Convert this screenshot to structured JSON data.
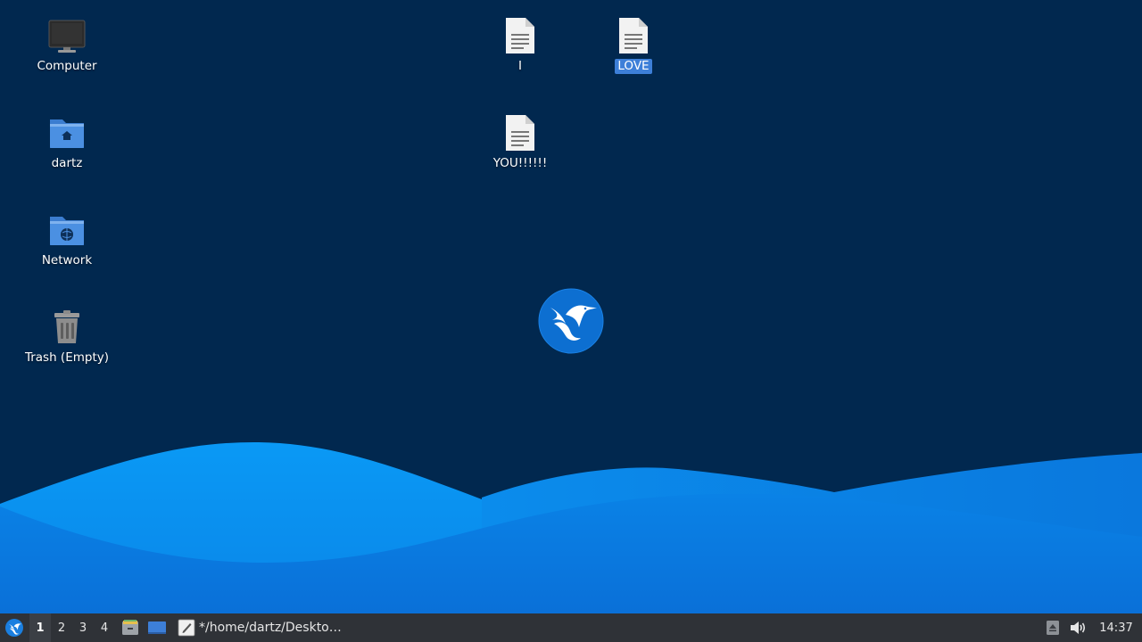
{
  "desktop": {
    "background_color": "#01284f",
    "icons": {
      "computer": {
        "label": "Computer"
      },
      "home": {
        "label": "dartz"
      },
      "network": {
        "label": "Network"
      },
      "trash": {
        "label": "Trash (Empty)"
      },
      "file_i": {
        "label": "I"
      },
      "file_love": {
        "label": "LOVE",
        "selected": true
      },
      "file_you": {
        "label": "YOU!!!!!!"
      }
    },
    "center_logo": "lubuntu-bird-logo"
  },
  "taskbar": {
    "menu_icon": "lubuntu-menu-icon",
    "workspaces": [
      "1",
      "2",
      "3",
      "4"
    ],
    "active_workspace": "1",
    "launchers": [
      "file-manager-icon",
      "show-desktop-icon"
    ],
    "task": {
      "icon": "text-editor-icon",
      "label": "*/home/dartz/Deskto…"
    },
    "tray": [
      "removable-media-icon",
      "volume-icon"
    ],
    "clock": "14:37"
  },
  "colors": {
    "accent": "#3d7fd8",
    "wave_light": "#0a8ff0",
    "wave_dark": "#0066cc",
    "panel": "#2f3237"
  }
}
